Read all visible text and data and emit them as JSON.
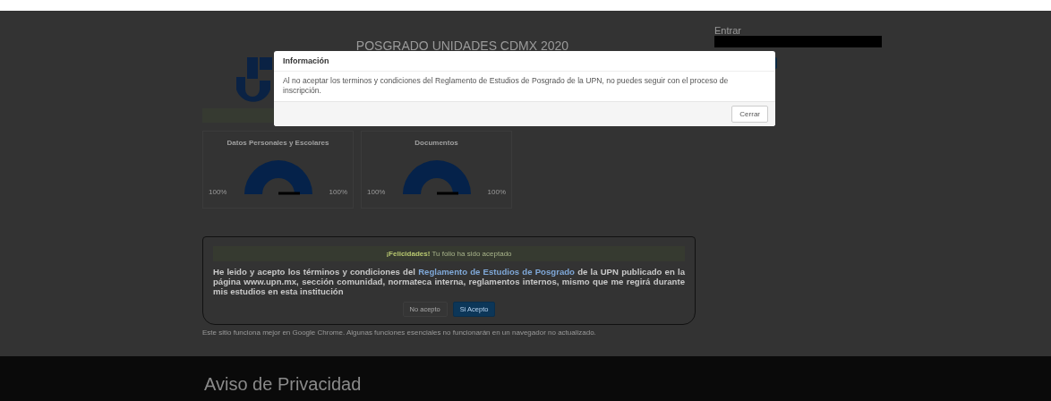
{
  "header": {
    "title": "POSGRADO UNIDADES CDMX 2020"
  },
  "login": {
    "label": "Entrar"
  },
  "progress_cards": [
    {
      "title": "Datos Personales y Escolares",
      "min_label": "100%",
      "max_label": "100%"
    },
    {
      "title": "Documentos",
      "min_label": "100%",
      "max_label": "100%"
    }
  ],
  "terms": {
    "alert": "**¡Felicidades!** Tu folio ha sido aceptado",
    "text_before": "He leido y acepto los términos y condiciones del",
    "link": "Reglamento de Estudios de Posgrado",
    "text_after": "de la UPN publicado en la página www.upn.mx, sección comunidad, normateca interna, reglamentos internos, mismo que me regirá durante mis estudios en esta institución",
    "buttons": [
      {
        "label": "No acepto",
        "kind": "default"
      },
      {
        "label": "Si Acepto",
        "kind": "primary"
      }
    ]
  },
  "notice": "Este sitio funciona mejor en Google Chrome. Algunas funciones esenciales no funcionarán en un navegador no actualizado.",
  "footer": {
    "title": "Aviso de Privacidad"
  },
  "modal": {
    "title": "Información",
    "message": "Al no aceptar los terminos y condiciones del Reglamento de Estudios de Posgrado de la UPN, no puedes seguir con el proceso de inscripción.",
    "button": "Cerrar"
  }
}
